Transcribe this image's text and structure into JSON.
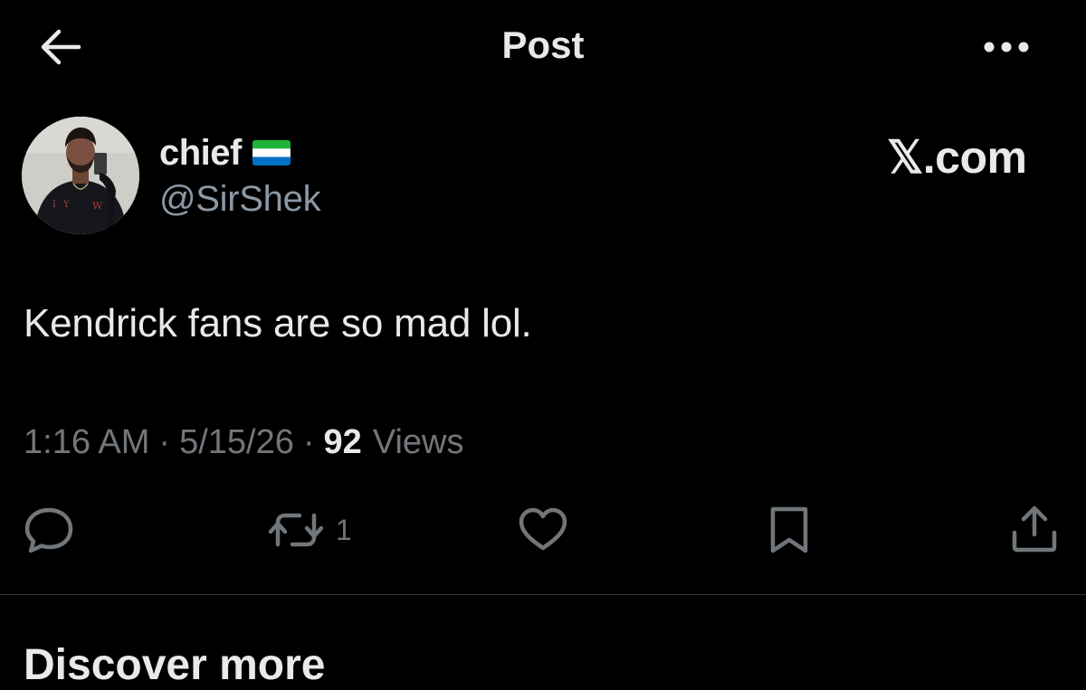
{
  "header": {
    "title": "Post",
    "back_icon": "arrow-left-icon",
    "more_icon": "ellipsis-icon"
  },
  "author": {
    "display_name": "chief",
    "handle": "@SirShek",
    "flag_icon": "sierra-leone-flag-icon"
  },
  "watermark": "𝕏.com",
  "tweet": {
    "text": "Kendrick fans are so mad lol."
  },
  "meta": {
    "time": "1:16 AM",
    "separator": "·",
    "date": "5/15/26",
    "views_count": "92",
    "views_label": "Views"
  },
  "actions": {
    "reply_icon": "reply-bubble-icon",
    "repost_icon": "repost-icon",
    "repost_count": "1",
    "like_icon": "heart-icon",
    "bookmark_icon": "bookmark-icon",
    "share_icon": "share-icon"
  },
  "next_section": {
    "title": "Discover more"
  },
  "colors": {
    "background": "#000000",
    "primary_text": "#e7e9ea",
    "secondary_text": "#71767b",
    "divider": "#2f3336"
  }
}
